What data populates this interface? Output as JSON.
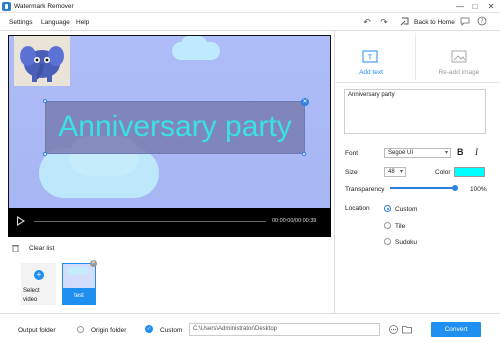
{
  "window": {
    "title": "Watermark Remover",
    "controls": [
      "—",
      "□",
      "✕"
    ]
  },
  "menu": {
    "items": [
      "Settings",
      "Language",
      "Help"
    ],
    "back_home": "Back to Home"
  },
  "player": {
    "time": "00:00:00/00:00:39",
    "overlay_text": "Anniversary party"
  },
  "media": {
    "clear_list": "Clear list",
    "select_video_line1": "Select",
    "select_video_line2": "video",
    "items": [
      {
        "label": "test"
      }
    ]
  },
  "panel": {
    "tabs": [
      {
        "label": "Add text",
        "active": true
      },
      {
        "label": "Re-add image",
        "active": false
      }
    ],
    "text_value": "Anniversary party",
    "font_label": "Font",
    "font_value": "Segoe UI",
    "bold": "B",
    "italic": "I",
    "size_label": "Size",
    "size_value": "48",
    "color_label": "Color",
    "color_value": "#00ffff",
    "transparency_label": "Transparency",
    "transparency_value": "100%",
    "location_label": "Location",
    "location_options": [
      {
        "label": "Custom",
        "checked": true
      },
      {
        "label": "Tile",
        "checked": false
      },
      {
        "label": "Sudoku",
        "checked": false
      }
    ]
  },
  "output": {
    "label": "Output folder",
    "origin_label": "Origin folder",
    "custom_label": "Custom",
    "path": "C:\\Users\\Administrator\\Desktop",
    "convert": "Convert"
  },
  "colors": {
    "accent": "#1f8ff0",
    "overlay_text": "#39e3e0"
  }
}
